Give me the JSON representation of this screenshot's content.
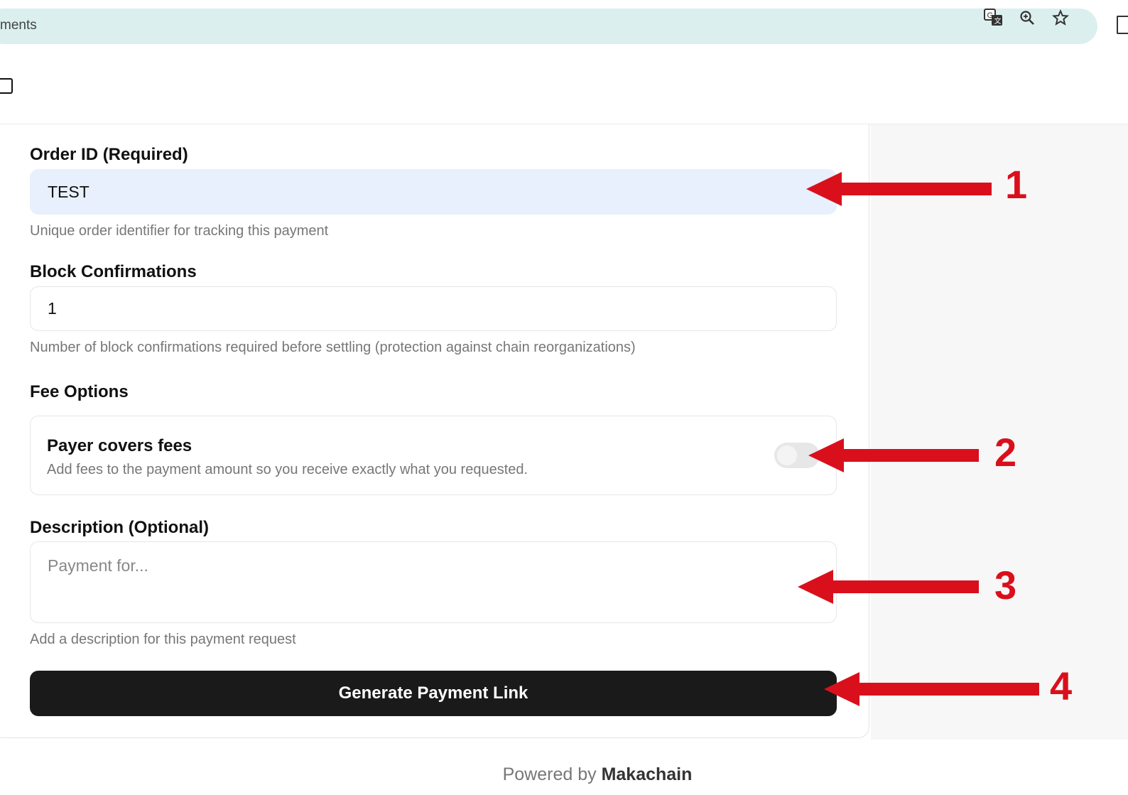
{
  "browser": {
    "address_text": "ments",
    "icons": [
      "translate-icon",
      "zoom-icon",
      "star-icon",
      "extensions-icon"
    ]
  },
  "form": {
    "order_id": {
      "label": "Order ID (Required)",
      "value": "TEST",
      "hint": "Unique order identifier for tracking this payment"
    },
    "block_confirmations": {
      "label": "Block Confirmations",
      "value": "1",
      "hint": "Number of block confirmations required before settling (protection against chain reorganizations)"
    },
    "fee_options": {
      "label": "Fee Options",
      "title": "Payer covers fees",
      "description": "Add fees to the payment amount so you receive exactly what you requested.",
      "enabled": false
    },
    "description": {
      "label": "Description (Optional)",
      "placeholder": "Payment for...",
      "hint": "Add a description for this payment request"
    },
    "submit_label": "Generate Payment Link"
  },
  "footer": {
    "powered_prefix": "Powered by",
    "brand": "Makachain"
  },
  "annotations": [
    "1",
    "2",
    "3",
    "4"
  ],
  "colors": {
    "annotation": "#d9101c",
    "button": "#1a1a1a",
    "address_bar": "#dbefee",
    "filled_input": "#e8f0fe"
  }
}
